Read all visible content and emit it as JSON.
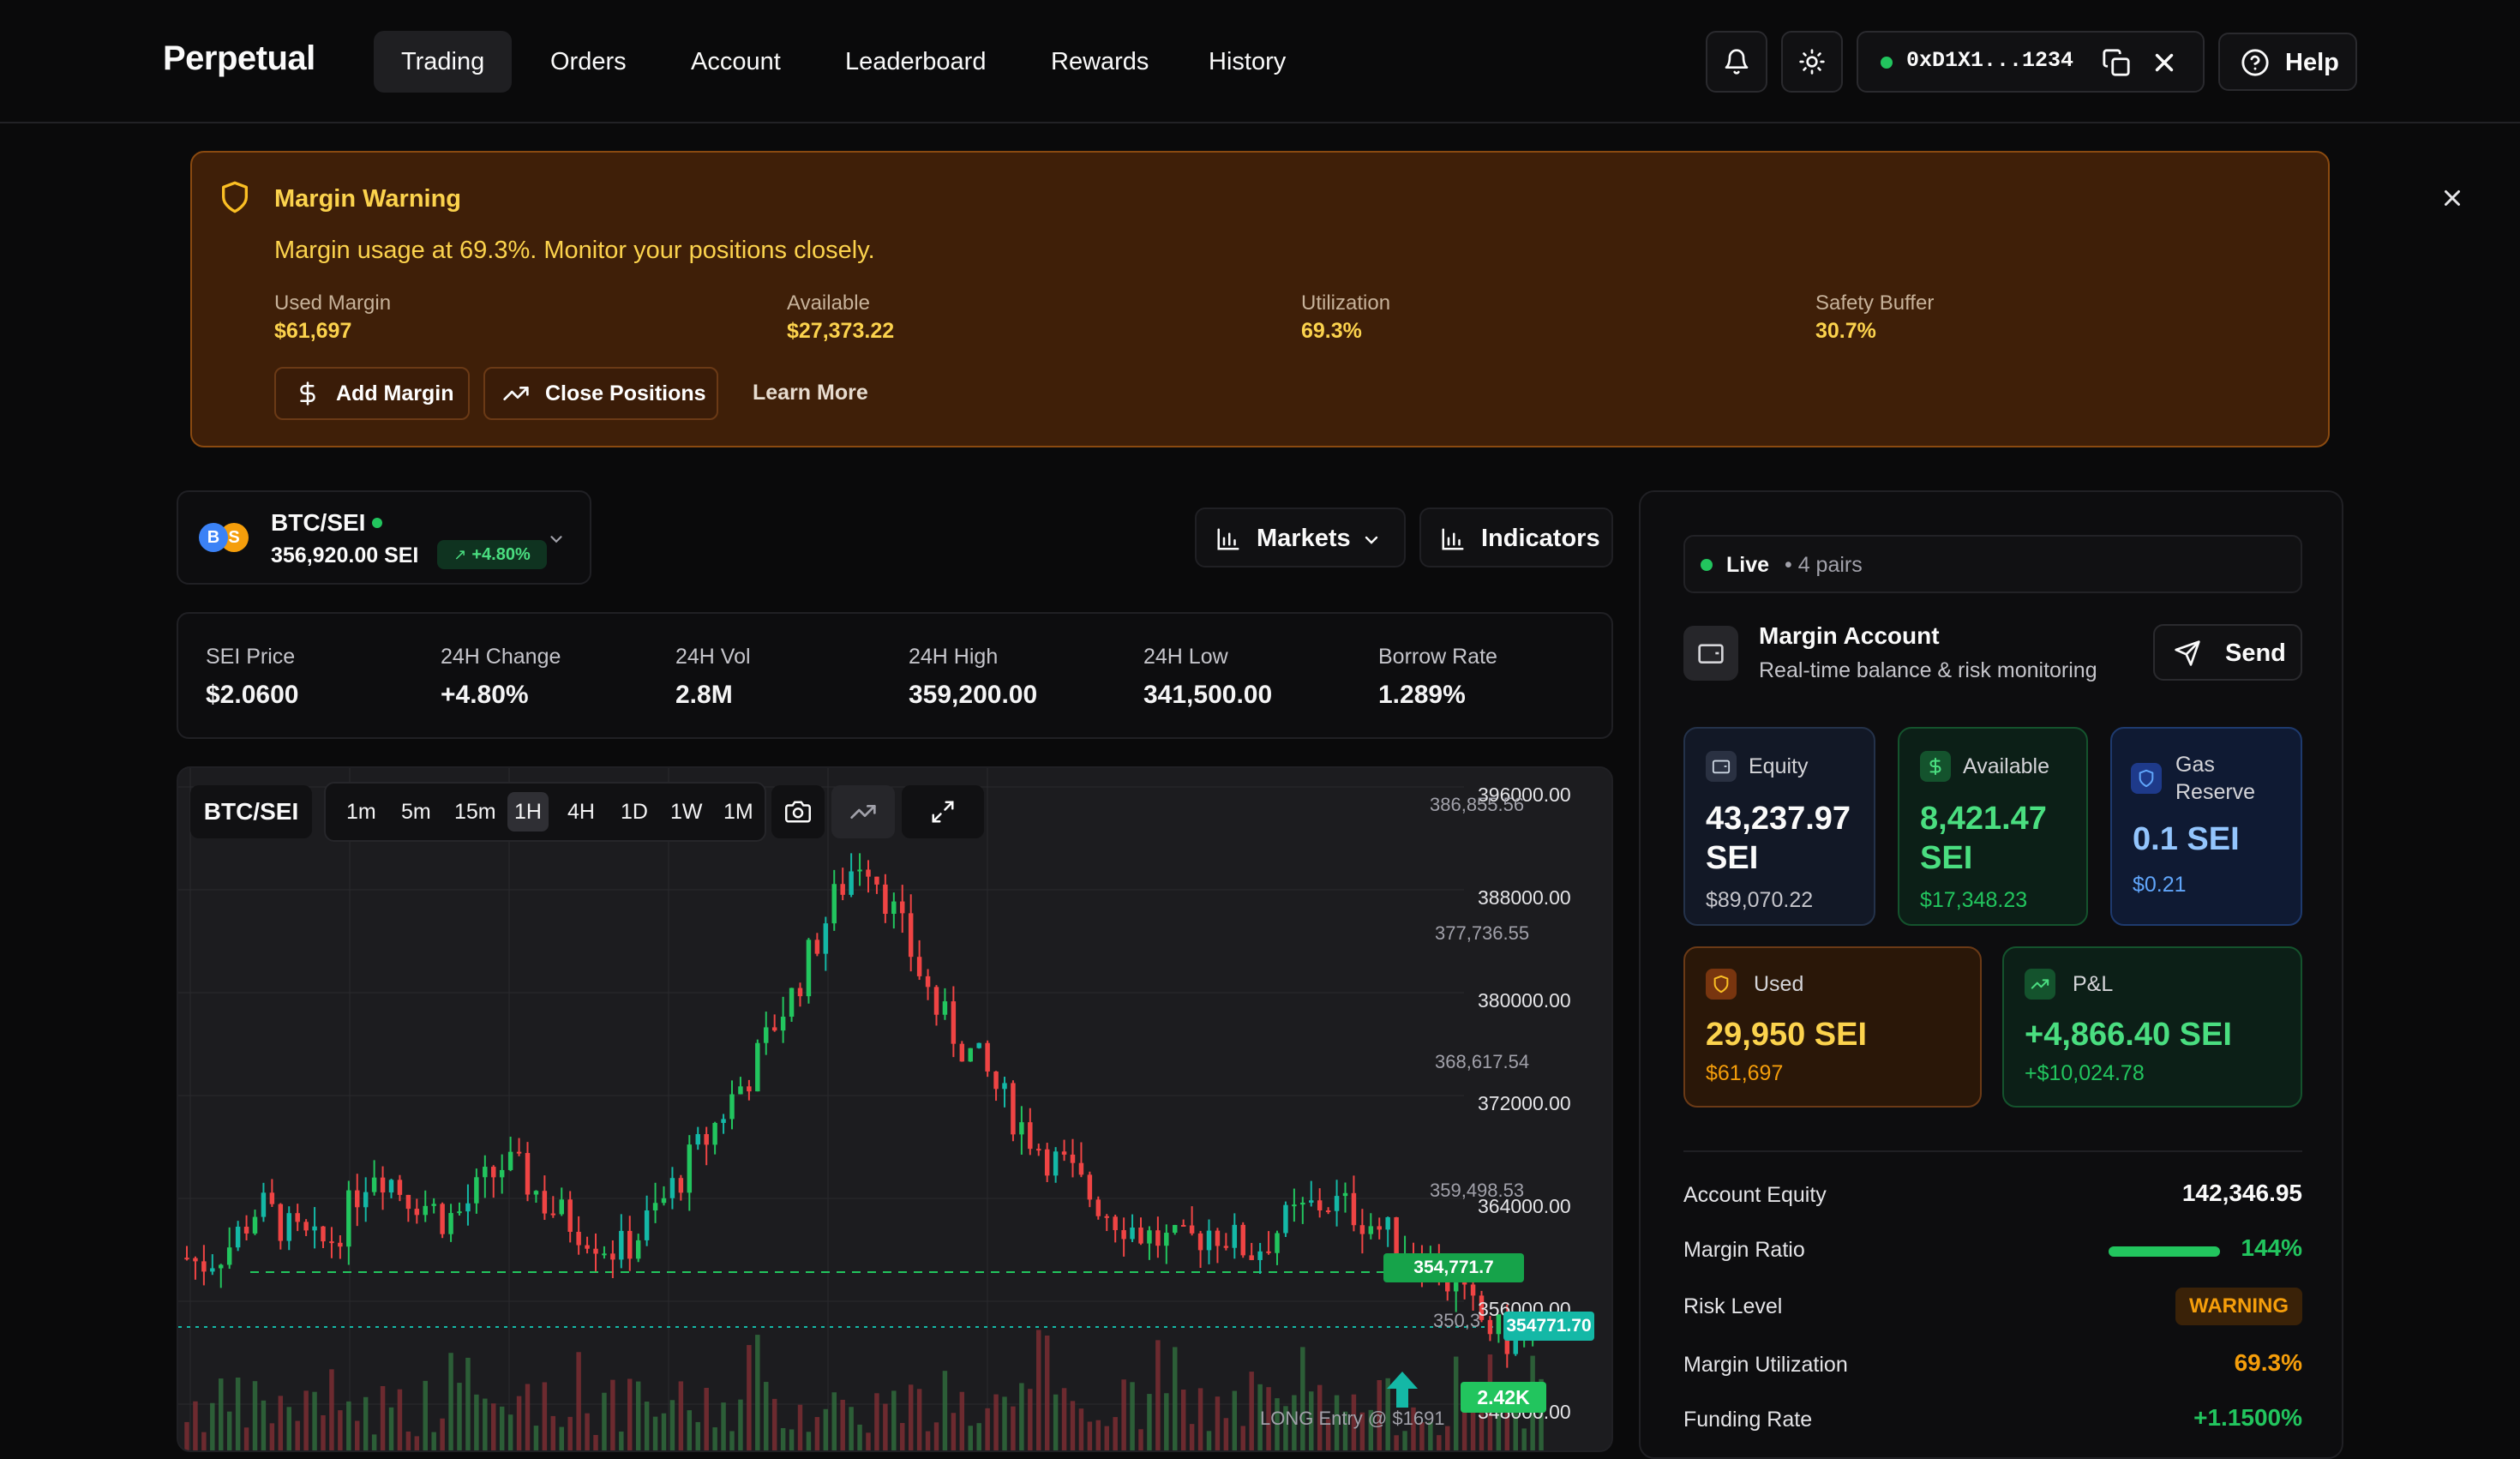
{
  "app": {
    "name": "Perpetual"
  },
  "nav": {
    "tabs": [
      {
        "label": "Trading"
      },
      {
        "label": "Orders"
      },
      {
        "label": "Account"
      },
      {
        "label": "Leaderboard"
      },
      {
        "label": "Rewards"
      },
      {
        "label": "History"
      }
    ],
    "active_tab": "Trading",
    "wallet_address": "0xD1X1...1234",
    "wallet_status_color": "#22c55e",
    "help_label": "Help"
  },
  "warning": {
    "title": "Margin Warning",
    "message": "Margin usage at 69.3%. Monitor your positions closely.",
    "stats": [
      {
        "label": "Used Margin",
        "value": "$61,697"
      },
      {
        "label": "Available",
        "value": "$27,373.22"
      },
      {
        "label": "Utilization",
        "value": "69.3%"
      },
      {
        "label": "Safety Buffer",
        "value": "30.7%"
      }
    ],
    "add_margin_label": "Add Margin",
    "close_positions_label": "Close Positions",
    "learn_more_label": "Learn More"
  },
  "pair": {
    "name": "BTC/SEI",
    "base_badge": "B",
    "quote_badge": "S",
    "price": "356,920.00 SEI",
    "change": "+4.80%"
  },
  "toolbar": {
    "markets_label": "Markets",
    "indicators_label": "Indicators"
  },
  "stats": [
    {
      "label": "SEI Price",
      "value": "$2.0600",
      "color": "#fafafa"
    },
    {
      "label": "24H Change",
      "value": "+4.80%",
      "color": "#22c55e"
    },
    {
      "label": "24H Vol",
      "value": "2.8M",
      "color": "#fafafa"
    },
    {
      "label": "24H High",
      "value": "359,200.00",
      "color": "#22c55e"
    },
    {
      "label": "24H Low",
      "value": "341,500.00",
      "color": "#ef4444"
    },
    {
      "label": "Borrow Rate",
      "value": "1.289%",
      "color": "#f59e0b"
    }
  ],
  "chart": {
    "symbol": "BTC/SEI",
    "timeframes": [
      "1m",
      "5m",
      "15m",
      "1H",
      "4H",
      "1D",
      "1W",
      "1M"
    ],
    "active_timeframe": "1H",
    "price_axis": [
      "396000.00",
      "388000.00",
      "380000.00",
      "372000.00",
      "364000.00",
      "356000.00",
      "348000.00"
    ],
    "level_labels": [
      "386,855.56",
      "377,736.55",
      "368,617.54",
      "359,498.53",
      "350,3"
    ],
    "current_price_label": "354771.70",
    "entry_price_tag": "354,771.7",
    "volume_tag": "2.42K",
    "entry_text": "LONG Entry @ $1691"
  },
  "chart_data": {
    "type": "candlestick",
    "ylim": [
      346000,
      397000
    ],
    "close_series": [
      361000,
      360500,
      361200,
      362000,
      363500,
      365000,
      364200,
      363000,
      362500,
      361800,
      362400,
      364000,
      366500,
      368000,
      367200,
      366000,
      365500,
      364800,
      363900,
      364500,
      365800,
      367000,
      368200,
      367500,
      366400,
      365000,
      364200,
      363500,
      362800,
      362000,
      361500,
      362300,
      363800,
      365200,
      366800,
      368500,
      370000,
      371800,
      373500,
      375000,
      377000,
      379500,
      381000,
      383500,
      386000,
      388500,
      390500,
      392000,
      390000,
      387500,
      385000,
      382500,
      380000,
      378500,
      377000,
      375800,
      374200,
      372500,
      371000,
      369800,
      368500,
      367800,
      366500,
      365500,
      364500,
      363800,
      363000,
      362500,
      362200,
      361800,
      362500,
      363200,
      362800,
      362000,
      361500,
      362400,
      363500,
      364200,
      364800,
      365300,
      365000,
      364500,
      363800,
      363000,
      362200,
      361500,
      360800,
      359800,
      358500,
      357200,
      356000,
      355200,
      354500,
      355200,
      354771
    ],
    "volume_note": "bottom volume bars shown red/green per candle"
  },
  "account": {
    "live_label": "Live",
    "pairs_label": "• 4 pairs",
    "title": "Margin Account",
    "subtitle": "Real-time balance & risk monitoring",
    "send_label": "Send",
    "cards": {
      "equity": {
        "label": "Equity",
        "value": "43,237.97 SEI",
        "sub": "$89,070.22"
      },
      "available": {
        "label": "Available",
        "value": "8,421.47 SEI",
        "sub": "$17,348.23"
      },
      "gas": {
        "label": "Gas Reserve",
        "value": "0.1 SEI",
        "sub": "$0.21"
      },
      "used": {
        "label": "Used",
        "value": "29,950 SEI",
        "sub": "$61,697"
      },
      "pnl": {
        "label": "P&L",
        "value": "+4,866.40 SEI",
        "sub": "+$10,024.78"
      }
    },
    "rows": [
      {
        "label": "Account Equity",
        "value": "142,346.95",
        "color": "#fafafa"
      },
      {
        "label": "Margin Ratio",
        "value": "144%",
        "color": "#22c55e"
      },
      {
        "label": "Risk Level",
        "value": "WARNING",
        "color": "#f59e0b"
      },
      {
        "label": "Margin Utilization",
        "value": "69.3%",
        "color": "#f59e0b"
      },
      {
        "label": "Funding Rate",
        "value": "+1.1500%",
        "color": "#22c55e"
      }
    ],
    "margin_ratio_fill": 1.0
  },
  "colors": {
    "up": "#22c55e",
    "down": "#ef4444",
    "warning": "#f59e0b",
    "teal": "#14b8a6"
  }
}
